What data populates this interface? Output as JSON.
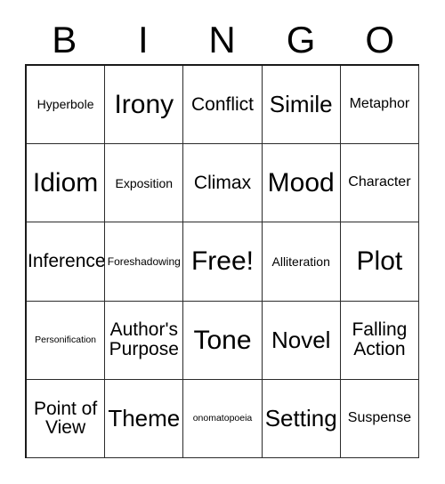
{
  "card": {
    "header_letters": [
      "B",
      "I",
      "N",
      "G",
      "O"
    ],
    "grid": {
      "rows": 5,
      "columns": 5,
      "cells": [
        {
          "text": "Hyperbole",
          "size": "s"
        },
        {
          "text": "Irony",
          "size": "xxl"
        },
        {
          "text": "Conflict",
          "size": "l"
        },
        {
          "text": "Simile",
          "size": "xl"
        },
        {
          "text": "Metaphor",
          "size": "m"
        },
        {
          "text": "Idiom",
          "size": "xxl"
        },
        {
          "text": "Exposition",
          "size": "s"
        },
        {
          "text": "Climax",
          "size": "l"
        },
        {
          "text": "Mood",
          "size": "xxl"
        },
        {
          "text": "Character",
          "size": "m"
        },
        {
          "text": "Inference",
          "size": "l"
        },
        {
          "text": "Foreshadowing",
          "size": "xs"
        },
        {
          "text": "Free!",
          "size": "xxl"
        },
        {
          "text": "Alliteration",
          "size": "s"
        },
        {
          "text": "Plot",
          "size": "xxl"
        },
        {
          "text": "Personification",
          "size": "xxs"
        },
        {
          "text": "Author's\nPurpose",
          "size": "l"
        },
        {
          "text": "Tone",
          "size": "xxl"
        },
        {
          "text": "Novel",
          "size": "xl"
        },
        {
          "text": "Falling\nAction",
          "size": "l"
        },
        {
          "text": "Point of\nView",
          "size": "l"
        },
        {
          "text": "Theme",
          "size": "xl"
        },
        {
          "text": "onomatopoeia",
          "size": "xxs"
        },
        {
          "text": "Setting",
          "size": "xl"
        },
        {
          "text": "Suspense",
          "size": "m"
        }
      ]
    }
  },
  "colors": {
    "background": "#ffffff",
    "text": "#000000",
    "grid_line": "#2b2b2b",
    "outer_border": "#1a1a1a"
  }
}
